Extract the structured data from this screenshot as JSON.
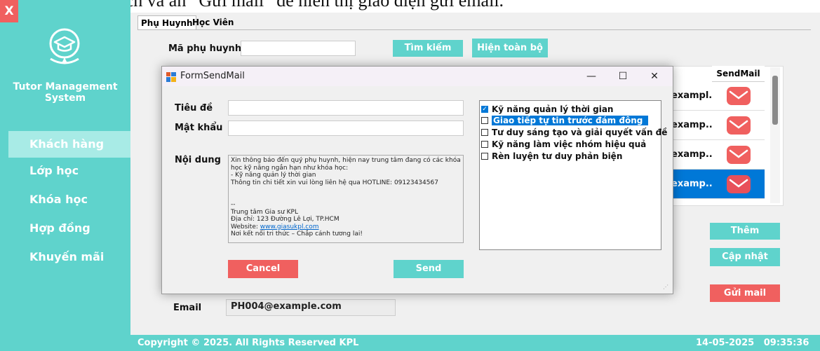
{
  "caption": "danh sách và ấn “Gửi mail” để hiển thị giao diện gửi email.",
  "sidebar": {
    "close_label": "X",
    "app_title": "Tutor Management System",
    "nav": [
      "Khách hàng",
      "Lớp học",
      "Khóa học",
      "Hợp đồng",
      "Khuyến mãi"
    ],
    "active_index": 0
  },
  "tabs": [
    "Phụ Huynh",
    "Học Viên"
  ],
  "search": {
    "label": "Mã phụ huynh",
    "value": "",
    "search_button": "Tìm kiếm",
    "show_all_button": "Hiện toàn bộ"
  },
  "grid": {
    "header": "SendMail",
    "rows": [
      {
        "email": "exampl...",
        "selected": false
      },
      {
        "email": "examp...",
        "selected": false
      },
      {
        "email": "examp...",
        "selected": false
      },
      {
        "email": "examp...",
        "selected": true
      }
    ]
  },
  "actions": {
    "add": "Thêm",
    "update": "Cập nhật",
    "send_mail": "Gửi mail"
  },
  "email_field": {
    "label": "Email",
    "value": "PH004@example.com"
  },
  "footer": {
    "copyright": "Copyright © 2025. All Rights Reserved KPL",
    "datetime": "14-05-2025   09:35:36"
  },
  "dialog": {
    "title": "FormSendMail",
    "subject_label": "Tiêu đề",
    "subject_value": "",
    "password_label": "Mật khẩu",
    "password_value": "",
    "content_label": "Nội dung",
    "content_lines": [
      "Xin thông báo đến quý phụ huynh, hiện nay trung tâm đang có các khóa",
      "học kỹ năng ngắn hạn như khóa học:",
      "- Kỹ năng quản lý thời gian",
      "Thông tin chi tiết xin vui lòng liên hệ qua HOTLINE: 09123434567",
      "",
      "",
      "--",
      "Trung tâm Gia sư KPL",
      "Địa chỉ: 123 Đường Lê Lợi, TP.HCM"
    ],
    "website_prefix": "Website: ",
    "website": "www.giasukpl.com",
    "slogan": "Nơi kết nối tri thức – Chắp cánh tương lai!",
    "cancel_button": "Cancel",
    "send_button": "Send",
    "minimize": "—",
    "maximize": "☐",
    "close": "✕",
    "courses": [
      {
        "label": "Kỹ năng quản lý thời gian",
        "checked": true,
        "highlight": false
      },
      {
        "label": "Giao tiếp tự tin trước đám đông",
        "checked": false,
        "highlight": true
      },
      {
        "label": "Tư duy sáng tạo và giải quyết vấn đề",
        "checked": false,
        "highlight": false
      },
      {
        "label": "Kỹ năng làm việc nhóm hiệu quả",
        "checked": false,
        "highlight": false
      },
      {
        "label": "Rèn luyện tư duy phản biện",
        "checked": false,
        "highlight": false
      }
    ]
  },
  "colors": {
    "teal": "#5fd3cc",
    "red": "#f0605f",
    "selection": "#0078d7"
  }
}
